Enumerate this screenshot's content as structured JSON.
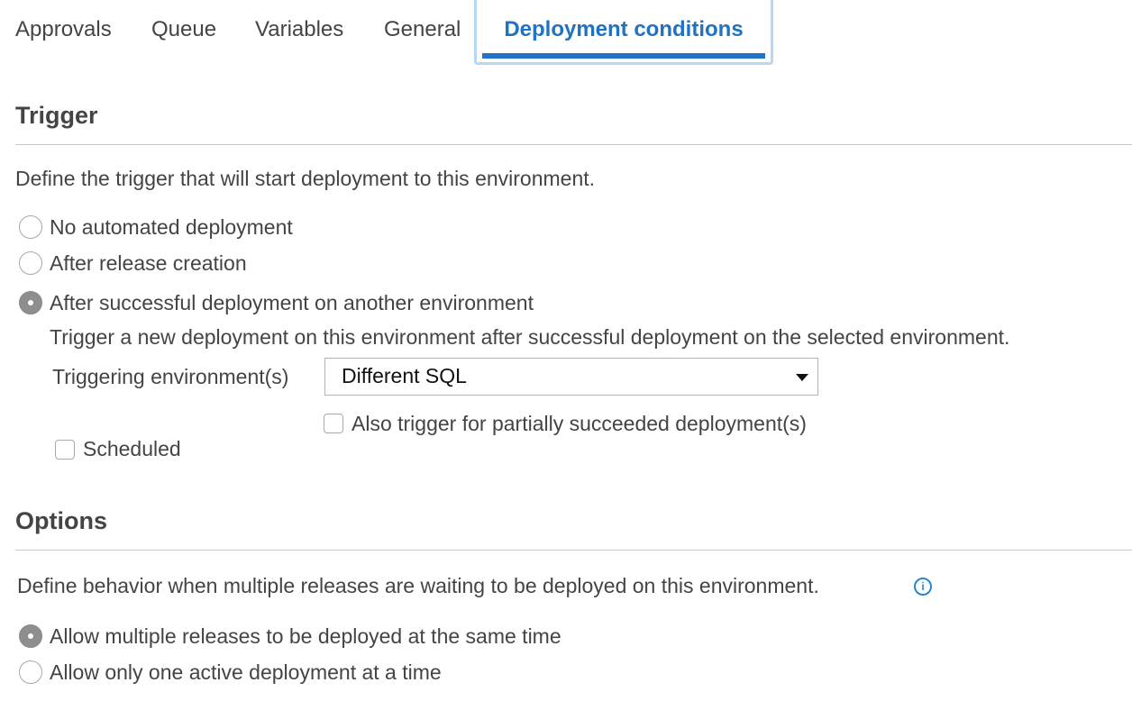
{
  "tabs": [
    {
      "label": "Approvals"
    },
    {
      "label": "Queue"
    },
    {
      "label": "Variables"
    },
    {
      "label": "General"
    },
    {
      "label": "Deployment conditions"
    }
  ],
  "active_tab": "Deployment conditions",
  "trigger": {
    "title": "Trigger",
    "description": "Define the trigger that will start deployment to this environment.",
    "options": [
      {
        "label": "No automated deployment",
        "checked": false
      },
      {
        "label": "After release creation",
        "checked": false
      },
      {
        "label": "After successful deployment on another environment",
        "checked": true
      }
    ],
    "sub_description": "Trigger a new deployment on this environment after successful deployment on the selected environment.",
    "environment_label": "Triggering environment(s)",
    "environment_value": "Different SQL",
    "partial_label": "Also trigger for partially succeeded deployment(s)",
    "partial_checked": false,
    "scheduled_label": "Scheduled",
    "scheduled_checked": false
  },
  "options": {
    "title": "Options",
    "description": "Define behavior when multiple releases are waiting to be deployed on this environment.",
    "info_icon": "info-icon",
    "choices": [
      {
        "label": "Allow multiple releases to be deployed at the same time",
        "checked": true
      },
      {
        "label": "Allow only one active deployment at a time",
        "checked": false
      }
    ]
  },
  "colors": {
    "accent": "#1f73c2",
    "tab_focus_border": "#b8d7f2",
    "text": "#444444"
  }
}
